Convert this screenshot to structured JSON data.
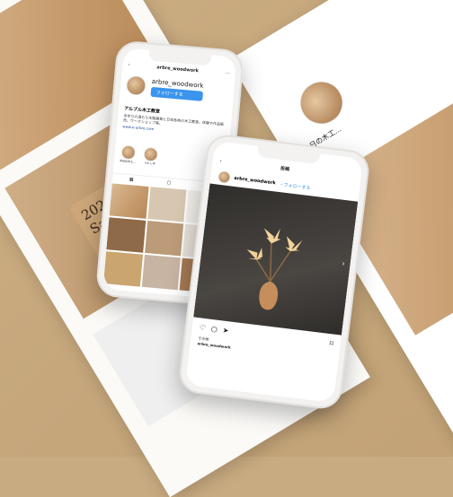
{
  "phone1": {
    "username": "arbre_woodwork",
    "follow_label": "フォローする",
    "bio_title": "アルブル木工教室",
    "bio_text": "手作りの温もり木製雑貨と日本各地の木工教室。体験や作品販売、ワークショップ等。",
    "link": "www.e-arbre.com",
    "highlights": [
      "今日の木工...",
      "ひとし木"
    ]
  },
  "phone2": {
    "header": "投稿",
    "username": "arbre_woodwork",
    "follow_label": "・フォローする",
    "likes": "その他",
    "caption": "arbre_woodwork"
  },
  "right_panel": {
    "highlight_label": "今日の木工..."
  },
  "left_panel": {
    "tag_text": "2021/10/29 Saturday"
  }
}
